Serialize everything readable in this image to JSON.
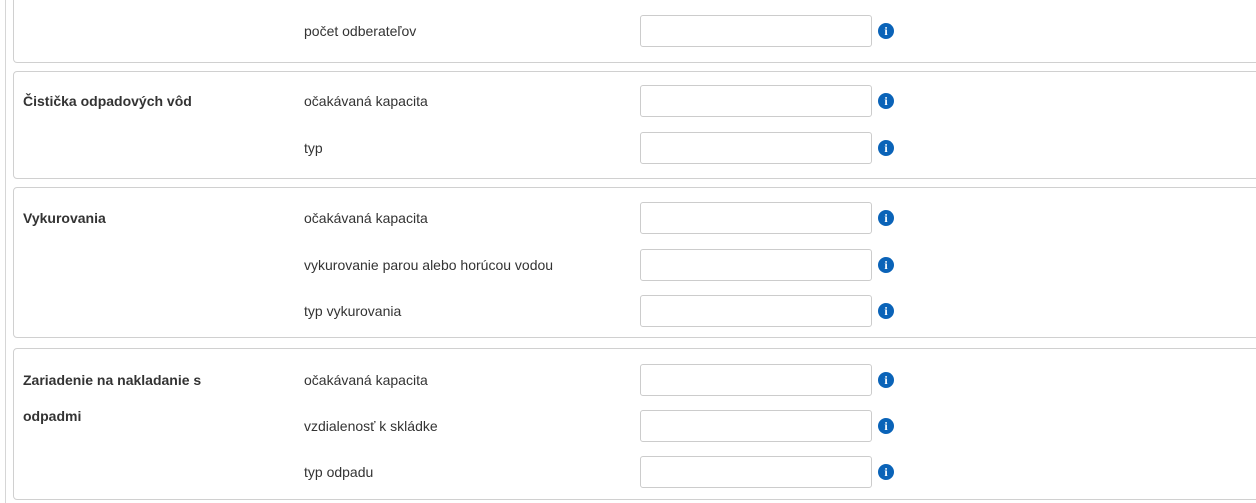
{
  "sections": [
    {
      "title": "",
      "rows": [
        {
          "label": "počet odberateľov",
          "value": "",
          "info_icon": "info-icon"
        }
      ]
    },
    {
      "title": "Čistička odpadových vôd",
      "rows": [
        {
          "label": "očakávaná kapacita",
          "value": "",
          "info_icon": "info-icon"
        },
        {
          "label": "typ",
          "value": "",
          "info_icon": "info-icon"
        }
      ]
    },
    {
      "title": "Vykurovania",
      "rows": [
        {
          "label": "očakávaná kapacita",
          "value": "",
          "info_icon": "info-icon"
        },
        {
          "label": "vykurovanie parou alebo horúcou vodou",
          "value": "",
          "info_icon": "info-icon"
        },
        {
          "label": "typ vykurovania",
          "value": "",
          "info_icon": "info-icon"
        }
      ]
    },
    {
      "title": "Zariadenie na nakladanie s odpadmi",
      "rows": [
        {
          "label": "očakávaná kapacita",
          "value": "",
          "info_icon": "info-icon"
        },
        {
          "label": "vzdialenosť k skládke",
          "value": "",
          "info_icon": "info-icon"
        },
        {
          "label": "typ odpadu",
          "value": "",
          "info_icon": "info-icon"
        }
      ]
    }
  ],
  "icon_glyph": "i",
  "colors": {
    "info_icon": "#0a63b8",
    "border": "#d0d0d0",
    "text": "#333333"
  }
}
